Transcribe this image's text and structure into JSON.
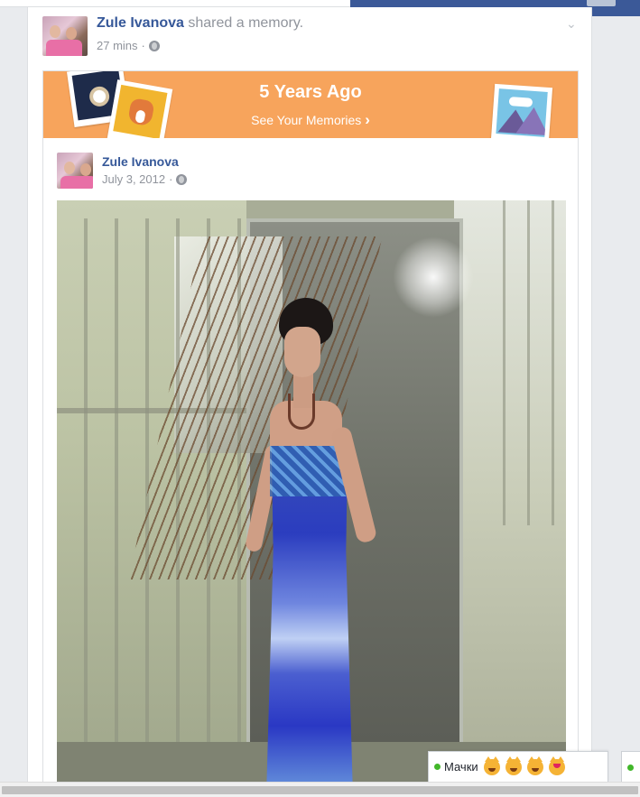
{
  "header": {
    "user_name": "Zule Ivanova",
    "action_text": " shared a memory.",
    "time": "27 mins",
    "separator": "·"
  },
  "banner": {
    "title": "5 Years Ago",
    "link_label": "See Your Memories",
    "link_chevron": "›",
    "color": "#f7a45c"
  },
  "post": {
    "author": "Zule Ivanova",
    "date": "July 3, 2012",
    "separator": "·"
  },
  "chat": {
    "tab_label": "Мачки",
    "status_color": "#42b72a",
    "emojis": [
      "cat-face-icon",
      "cat-face-icon",
      "cat-face-icon",
      "heart-eyes-cat-icon"
    ]
  },
  "colors": {
    "link_blue": "#365899",
    "topbar_blue": "#3b5998",
    "meta_gray": "#90949c"
  }
}
